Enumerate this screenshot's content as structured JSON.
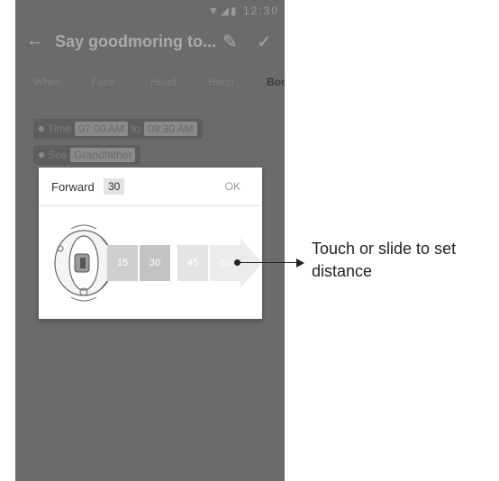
{
  "status_bar": {
    "time": "12:30"
  },
  "app_bar": {
    "title": "Say goodmoring to...",
    "back_icon": "arrow-left-icon",
    "edit_icon": "pencil-icon",
    "confirm_icon": "check-icon"
  },
  "tabs": [
    {
      "label": "When"
    },
    {
      "label": "Face"
    },
    {
      "label": "Head"
    },
    {
      "label": "Hand"
    },
    {
      "label": "Bod"
    }
  ],
  "conditions": {
    "time": {
      "label": "Time",
      "start": "07:00 AM",
      "connector": "to",
      "end": "08:30 AM"
    },
    "see": {
      "label": "See",
      "value": "Grandfather"
    }
  },
  "dialog": {
    "label": "Forward",
    "value": "30",
    "ok_label": "OK",
    "segments": [
      {
        "label": "15",
        "color": "#cfcfcf"
      },
      {
        "label": "30",
        "color": "#c3c3c3"
      },
      {
        "label": "45",
        "color": "#e4e4e4"
      },
      {
        "label": "60",
        "color": "#ececec"
      }
    ]
  },
  "annotation": {
    "text": "Touch or slide to set distance"
  },
  "colors": {
    "overlay": "#6b6b6b",
    "dialog_bg": "#ffffff",
    "selected_segment": "#c3c3c3"
  }
}
